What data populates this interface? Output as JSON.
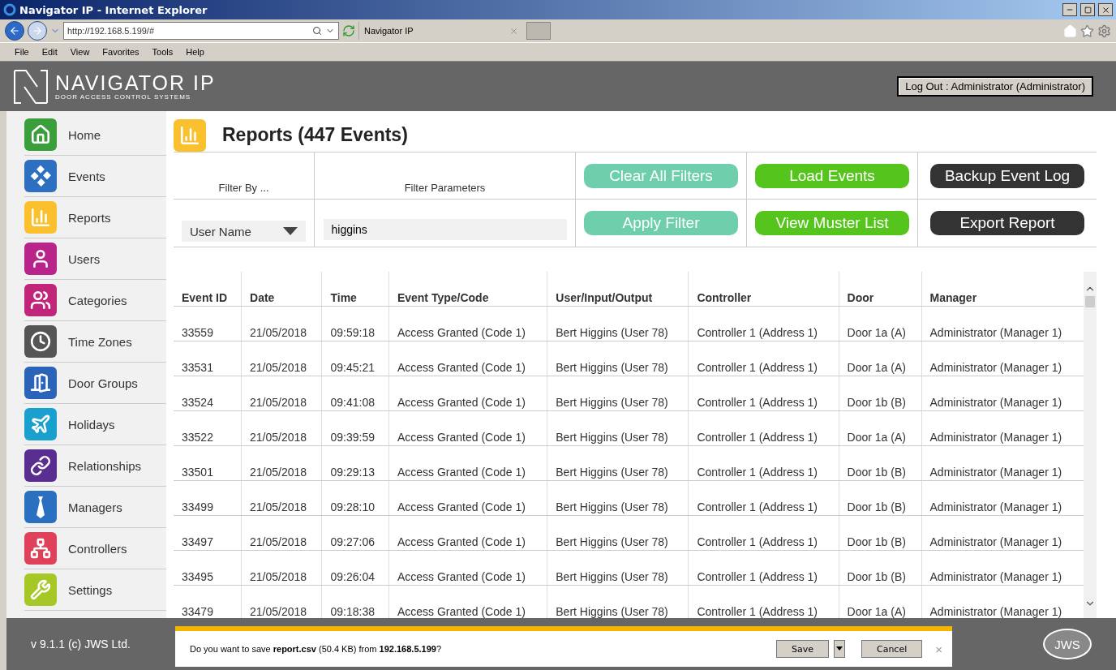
{
  "window": {
    "title": "Navigator IP - Internet Explorer"
  },
  "browser": {
    "address": "http://192.168.5.199/#",
    "tab": "Navigator IP",
    "menu": [
      "File",
      "Edit",
      "View",
      "Favorites",
      "Tools",
      "Help"
    ]
  },
  "header": {
    "logo_title": "NAVIGATOR IP",
    "logo_subtitle": "DOOR ACCESS CONTROL SYSTEMS",
    "logout": "Log Out : Administrator (Administrator)"
  },
  "sidebar": {
    "items": [
      {
        "label": "Home",
        "color": "#3a9e3a"
      },
      {
        "label": "Events",
        "color": "#2d6fc0"
      },
      {
        "label": "Reports",
        "color": "#fbc02d"
      },
      {
        "label": "Users",
        "color": "#b8248a"
      },
      {
        "label": "Categories",
        "color": "#c0257a"
      },
      {
        "label": "Time Zones",
        "color": "#555555"
      },
      {
        "label": "Door Groups",
        "color": "#2a63b8"
      },
      {
        "label": "Holidays",
        "color": "#1aa0cf"
      },
      {
        "label": "Relationships",
        "color": "#5a2d91"
      },
      {
        "label": "Managers",
        "color": "#2a6fc0"
      },
      {
        "label": "Controllers",
        "color": "#e0415a"
      },
      {
        "label": "Settings",
        "color": "#a6c826"
      }
    ]
  },
  "page": {
    "title": "Reports (447 Events)"
  },
  "filter": {
    "filter_by_label": "Filter By ...",
    "parameters_label": "Filter Parameters",
    "filter_by": "User Name",
    "parameter": "higgins"
  },
  "buttons": [
    {
      "label": "Clear All Filters",
      "kind": "filter"
    },
    {
      "label": "Load Events",
      "kind": "load"
    },
    {
      "label": "Backup Event Log",
      "kind": "dark"
    },
    {
      "label": "Apply Filter",
      "kind": "filter"
    },
    {
      "label": "View Muster List",
      "kind": "load"
    },
    {
      "label": "Export Report",
      "kind": "dark"
    }
  ],
  "table": {
    "columns": [
      "Event ID",
      "Date",
      "Time",
      "Event Type/Code",
      "User/Input/Output",
      "Controller",
      "Door",
      "Manager"
    ],
    "rows": [
      [
        "33559",
        "21/05/2018",
        "09:59:18",
        "Access Granted (Code 1)",
        "Bert Higgins (User 78)",
        "Controller 1 (Address 1)",
        "Door 1a (A)",
        "Administrator (Manager 1)"
      ],
      [
        "33531",
        "21/05/2018",
        "09:45:21",
        "Access Granted (Code 1)",
        "Bert Higgins (User 78)",
        "Controller 1 (Address 1)",
        "Door 1a (A)",
        "Administrator (Manager 1)"
      ],
      [
        "33524",
        "21/05/2018",
        "09:41:08",
        "Access Granted (Code 1)",
        "Bert Higgins (User 78)",
        "Controller 1 (Address 1)",
        "Door 1b (B)",
        "Administrator (Manager 1)"
      ],
      [
        "33522",
        "21/05/2018",
        "09:39:59",
        "Access Granted (Code 1)",
        "Bert Higgins (User 78)",
        "Controller 1 (Address 1)",
        "Door 1a (A)",
        "Administrator (Manager 1)"
      ],
      [
        "33501",
        "21/05/2018",
        "09:29:13",
        "Access Granted (Code 1)",
        "Bert Higgins (User 78)",
        "Controller 1 (Address 1)",
        "Door 1b (B)",
        "Administrator (Manager 1)"
      ],
      [
        "33499",
        "21/05/2018",
        "09:28:10",
        "Access Granted (Code 1)",
        "Bert Higgins (User 78)",
        "Controller 1 (Address 1)",
        "Door 1b (B)",
        "Administrator (Manager 1)"
      ],
      [
        "33497",
        "21/05/2018",
        "09:27:06",
        "Access Granted (Code 1)",
        "Bert Higgins (User 78)",
        "Controller 1 (Address 1)",
        "Door 1b (B)",
        "Administrator (Manager 1)"
      ],
      [
        "33495",
        "21/05/2018",
        "09:26:04",
        "Access Granted (Code 1)",
        "Bert Higgins (User 78)",
        "Controller 1 (Address 1)",
        "Door 1b (B)",
        "Administrator (Manager 1)"
      ],
      [
        "33479",
        "21/05/2018",
        "09:18:38",
        "Access Granted (Code 1)",
        "Bert Higgins (User 78)",
        "Controller 1 (Address 1)",
        "Door 1a (A)",
        "Administrator (Manager 1)"
      ]
    ]
  },
  "footer": {
    "version": "v 9.1.1 (c) JWS Ltd.",
    "logo": "JWS"
  },
  "download_bar": {
    "message": "Do you want to save **report.csv** (50.4 KB) from **192.168.5.199**?",
    "save": "Save",
    "cancel": "Cancel",
    "close": "×"
  }
}
